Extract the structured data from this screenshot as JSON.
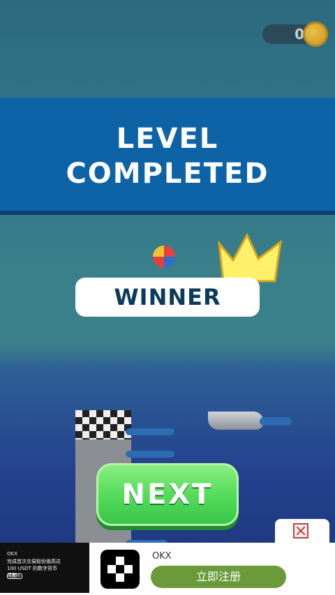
{
  "hud": {
    "coin_count": "0",
    "coin_icon": "coin-icon"
  },
  "banner": {
    "title": "LEVEL\nCOMPLETED"
  },
  "result": {
    "label": "WINNER",
    "crown_icon": "crown-icon",
    "ball_icon": "ball-icon"
  },
  "actions": {
    "next_label": "NEXT"
  },
  "ad": {
    "image_brand": "OKX",
    "image_text": "完成首次交易取份值高达 100 USDT 的数字货币 奖励",
    "image_cta": "立即注册",
    "app_name": "OKX",
    "cta_label": "立即注册",
    "close_icon": "close-icon"
  },
  "colors": {
    "banner": "#0d63a6",
    "next_button": "#56dc5c",
    "winner_text": "#0b3a5a"
  }
}
